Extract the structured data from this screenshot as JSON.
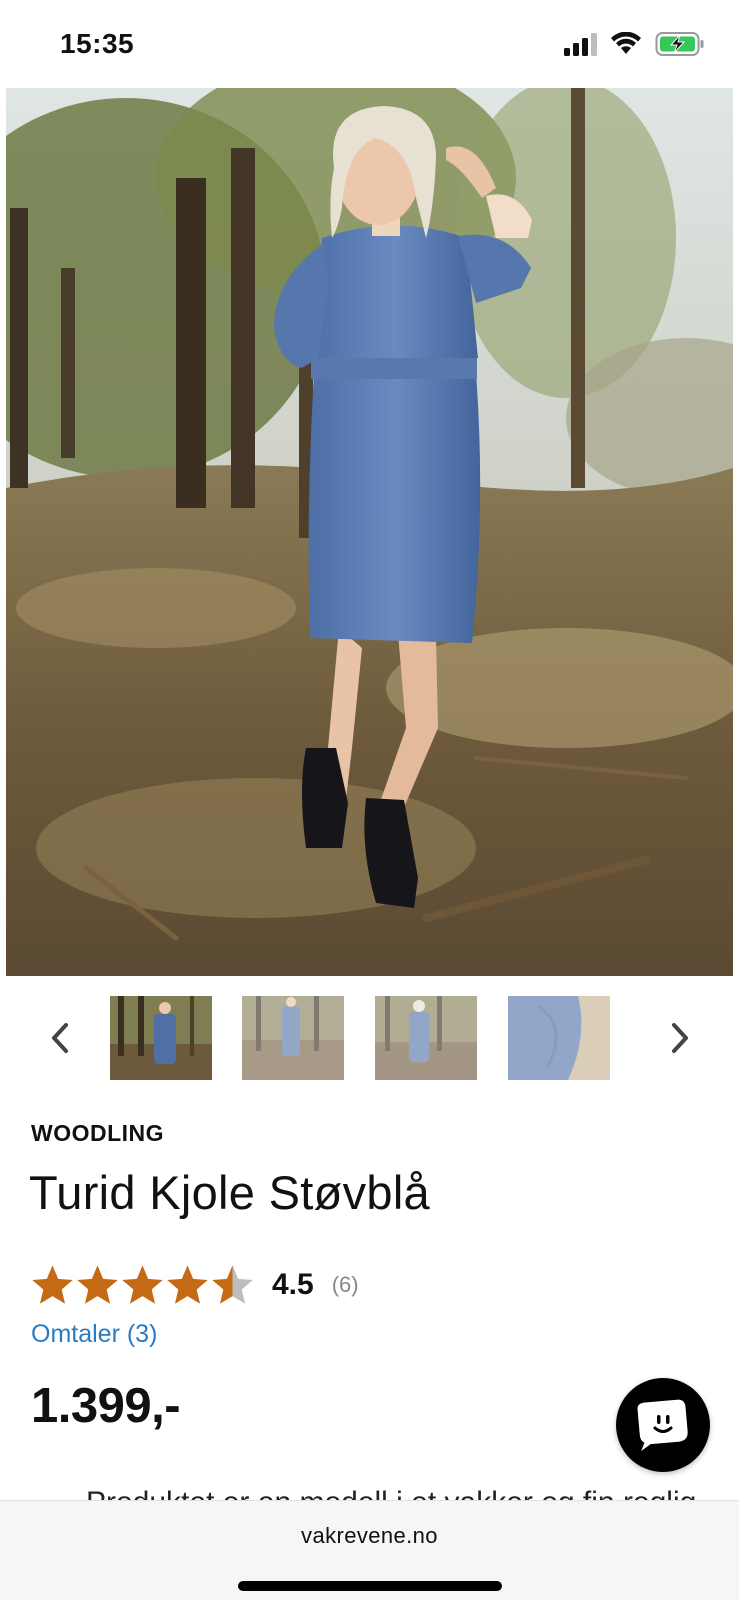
{
  "status_bar": {
    "time": "15:35",
    "icons": [
      "signal-icon",
      "wifi-icon",
      "battery-charging-icon"
    ]
  },
  "gallery": {
    "main_image": "woman-in-blue-corduroy-dress-forest",
    "thumbnails": [
      "thumb-front",
      "thumb-full",
      "thumb-back",
      "thumb-detail"
    ],
    "prev_icon": "chevron-left-icon",
    "next_icon": "chevron-right-icon"
  },
  "product": {
    "brand": "WOODLING",
    "title": "Turid Kjole Støvblå",
    "rating": 4.5,
    "rating_label": "4.5",
    "rating_count": "(6)",
    "reviews_link": "Omtaler (3)",
    "price": "1.399,-",
    "description_peek": "Produktet er en modell i et vakker og fin reglig"
  },
  "colors": {
    "star": "#c46a14",
    "star_empty": "#bdbdbd",
    "link": "#2a7cc2",
    "chat_fab": "#000000"
  },
  "browser": {
    "url": "vakrevene.no"
  }
}
